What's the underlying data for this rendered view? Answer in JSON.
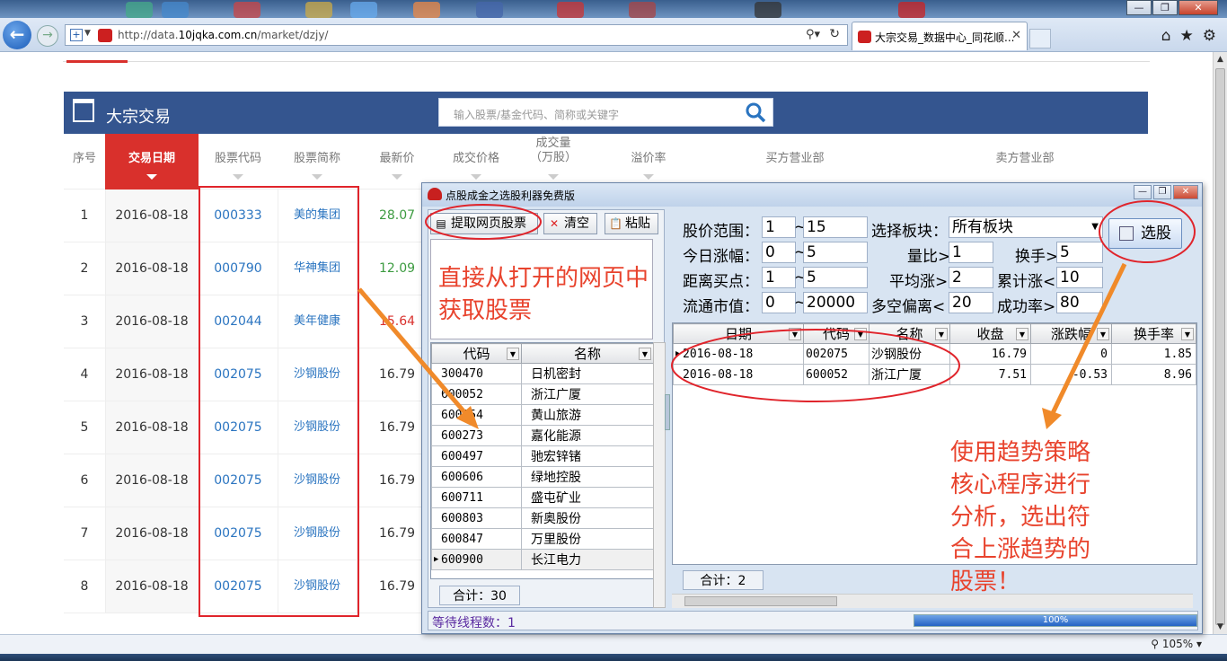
{
  "browser": {
    "url_prefix": "http://data.",
    "url_domain": "10jqka.com.cn",
    "url_path": "/market/dzjy/",
    "tab_title": "大宗交易_数据中心_同花顺...",
    "zoom": "105%"
  },
  "page": {
    "title": "大宗交易",
    "search_placeholder": "输入股票/基金代码、简称或关键字",
    "columns": [
      "序号",
      "交易日期",
      "股票代码",
      "股票简称",
      "最新价",
      "成交价格",
      "成交量\n（万股）",
      "溢价率",
      "买方营业部",
      "卖方营业部"
    ],
    "rows": [
      {
        "no": "1",
        "date": "2016-08-18",
        "code": "000333",
        "name": "美的集团",
        "price": "28.07",
        "trend": "up"
      },
      {
        "no": "2",
        "date": "2016-08-18",
        "code": "000790",
        "name": "华神集团",
        "price": "12.09",
        "trend": "up"
      },
      {
        "no": "3",
        "date": "2016-08-18",
        "code": "002044",
        "name": "美年健康",
        "price": "15.64",
        "trend": "down"
      },
      {
        "no": "4",
        "date": "2016-08-18",
        "code": "002075",
        "name": "沙钢股份",
        "price": "16.79",
        "trend": "flat"
      },
      {
        "no": "5",
        "date": "2016-08-18",
        "code": "002075",
        "name": "沙钢股份",
        "price": "16.79",
        "trend": "flat"
      },
      {
        "no": "6",
        "date": "2016-08-18",
        "code": "002075",
        "name": "沙钢股份",
        "price": "16.79",
        "trend": "flat"
      },
      {
        "no": "7",
        "date": "2016-08-18",
        "code": "002075",
        "name": "沙钢股份",
        "price": "16.79",
        "trend": "flat"
      },
      {
        "no": "8",
        "date": "2016-08-18",
        "code": "002075",
        "name": "沙钢股份",
        "price": "16.79",
        "trend": "flat"
      }
    ]
  },
  "app": {
    "title": "点股成金之选股利器免费版",
    "buttons": {
      "fetch": "提取网页股票",
      "clear": "清空",
      "paste": "粘贴",
      "select": "选股"
    },
    "memo_text": "直接从打开的网页中获取股票",
    "left_grid": {
      "headers": [
        "代码",
        "名称"
      ],
      "rows": [
        [
          "300470",
          "日机密封"
        ],
        [
          "600052",
          "浙江广厦"
        ],
        [
          "600054",
          "黄山旅游"
        ],
        [
          "600273",
          "嘉化能源"
        ],
        [
          "600497",
          "驰宏锌锗"
        ],
        [
          "600606",
          "绿地控股"
        ],
        [
          "600711",
          "盛屯矿业"
        ],
        [
          "600803",
          "新奥股份"
        ],
        [
          "600847",
          "万里股份"
        ],
        [
          "600900",
          "长江电力"
        ]
      ],
      "total": "合计：30"
    },
    "criteria": {
      "price_range_label": "股价范围：",
      "price_min": "1",
      "price_max": "15",
      "sector_label": "选择板块：",
      "sector_value": "所有板块",
      "today_change_label": "今日涨幅：",
      "today_min": "0",
      "today_max": "5",
      "vol_ratio_label": "量比>",
      "vol_ratio": "1",
      "turnover_label": "换手>",
      "turnover": "5",
      "buy_dist_label": "距离买点：",
      "buy_min": "1",
      "buy_max": "5",
      "avg_rise_label": "平均涨>",
      "avg_rise": "2",
      "cum_rise_label": "累计涨<",
      "cum_rise": "10",
      "float_cap_label": "流通市值：",
      "cap_min": "0",
      "cap_max": "20000",
      "bias_label": "多空偏离<",
      "bias": "20",
      "success_label": "成功率>",
      "success": "80",
      "tilde": "~"
    },
    "right_grid": {
      "headers": [
        "日期",
        "代码",
        "名称",
        "收盘",
        "涨跌幅",
        "换手率"
      ],
      "rows": [
        [
          "2016-08-18",
          "002075",
          "沙钢股份",
          "16.79",
          "0",
          "1.85"
        ],
        [
          "2016-08-18",
          "600052",
          "浙江广厦",
          "7.51",
          "-0.53",
          "8.96"
        ]
      ],
      "total": "合计：2"
    },
    "status_text": "等待线程数：1",
    "progress": 1.0,
    "progress_label": "100%"
  },
  "annotation": {
    "right_text": "使用趋势策略核心程序进行分析，选出符合上涨趋势的股票！",
    "color": "#e8432d"
  },
  "colors": {
    "header_blue": "#34558f",
    "active_red": "#d9302c",
    "link_blue": "#2a74c0"
  }
}
